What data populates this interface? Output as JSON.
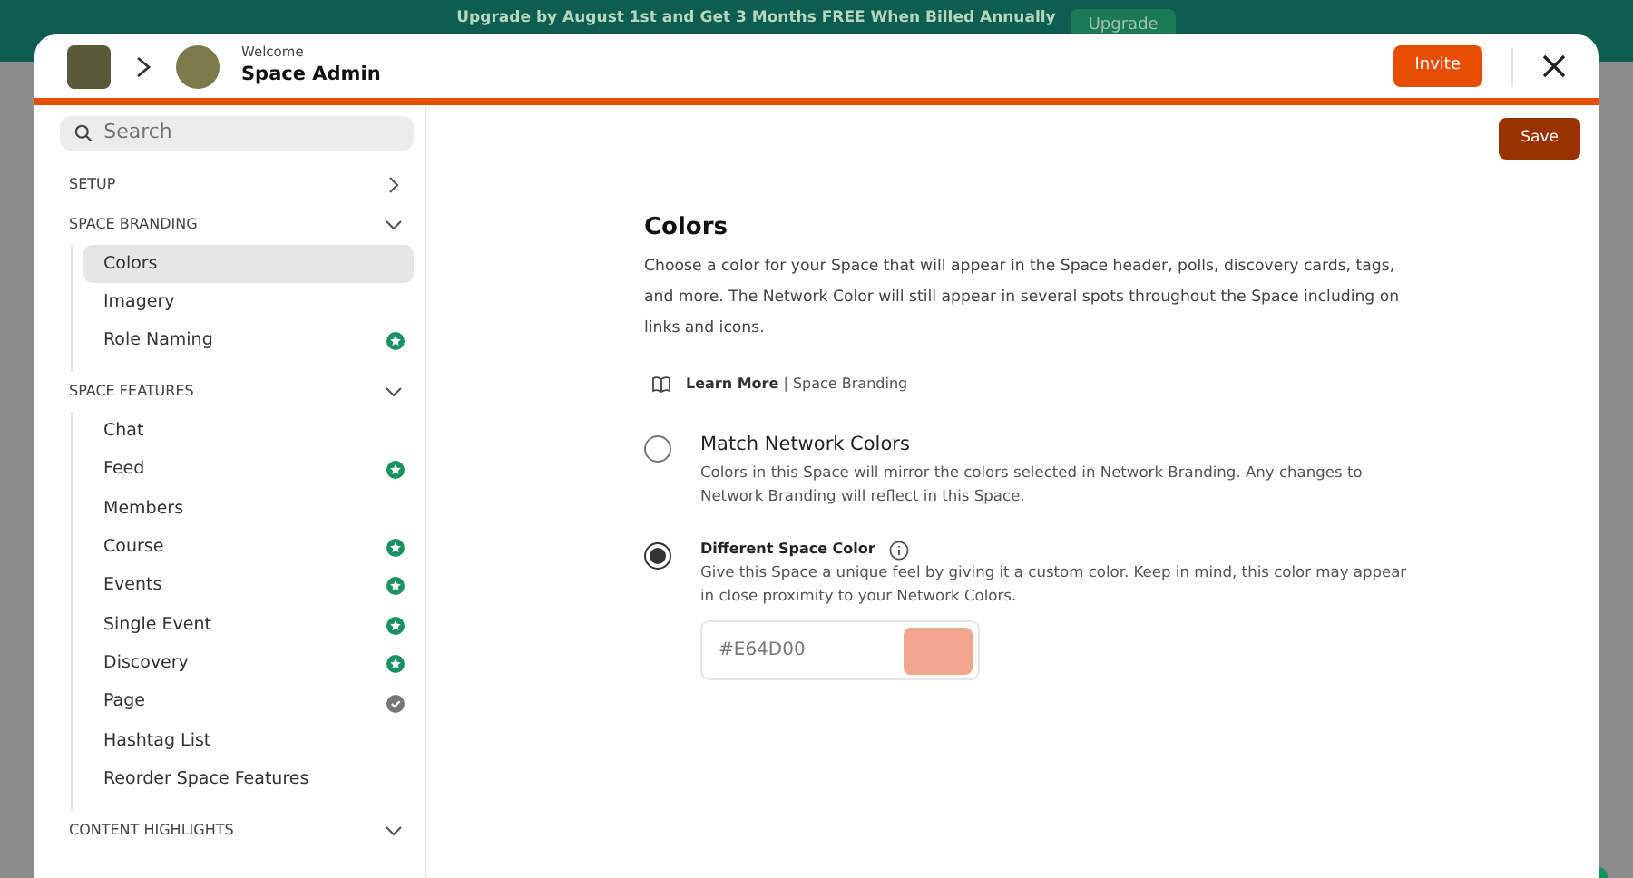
{
  "banner": {
    "text": "Upgrade by August 1st and Get 3 Months FREE When Billed Annually",
    "button": "Upgrade"
  },
  "header": {
    "subtitle": "Welcome",
    "title": "Space Admin",
    "invite_button": "Invite"
  },
  "search": {
    "placeholder": "Search"
  },
  "save_button": "Save",
  "sidebar": {
    "sections": [
      {
        "label": "SETUP",
        "expanded": false
      },
      {
        "label": "SPACE BRANDING",
        "expanded": true,
        "items": [
          {
            "label": "Colors",
            "selected": true,
            "kind": "plain"
          },
          {
            "label": "Imagery",
            "selected": false,
            "kind": "plain"
          },
          {
            "label": "Role Naming",
            "selected": false,
            "kind": "star"
          }
        ]
      },
      {
        "label": "SPACE FEATURES",
        "expanded": true,
        "items": [
          {
            "label": "Chat",
            "selected": false,
            "kind": "plain"
          },
          {
            "label": "Feed",
            "selected": false,
            "kind": "star"
          },
          {
            "label": "Members",
            "selected": false,
            "kind": "plain"
          },
          {
            "label": "Course",
            "selected": false,
            "kind": "star"
          },
          {
            "label": "Events",
            "selected": false,
            "kind": "star"
          },
          {
            "label": "Single Event",
            "selected": false,
            "kind": "star"
          },
          {
            "label": "Discovery",
            "selected": false,
            "kind": "star"
          },
          {
            "label": "Page",
            "selected": false,
            "kind": "check"
          },
          {
            "label": "Hashtag List",
            "selected": false,
            "kind": "plain"
          },
          {
            "label": "Reorder Space Features",
            "selected": false,
            "kind": "plain"
          }
        ]
      },
      {
        "label": "CONTENT HIGHLIGHTS",
        "expanded": true
      }
    ]
  },
  "content": {
    "title": "Colors",
    "description": "Choose a color for your Space that will appear in the Space header, polls, discovery cards, tags, and more. The Network Color will still appear in several spots throughout the Space including on links and icons.",
    "learn_more": {
      "link": "Learn More",
      "topic": "| Space Branding"
    },
    "options": [
      {
        "label": "Match Network Colors",
        "description": "Colors in this Space will mirror the colors selected in Network Branding. Any changes to Network Branding will reflect in this Space.",
        "selected": false,
        "info": false
      },
      {
        "label": "Different Space Color",
        "description": "Give this Space a unique feel by giving it a custom color. Keep in mind, this color may appear in close proximity to your Network Colors.",
        "selected": true,
        "info": true
      }
    ],
    "color_field": {
      "value": "#E64D00",
      "color": "#f2a68c"
    }
  }
}
